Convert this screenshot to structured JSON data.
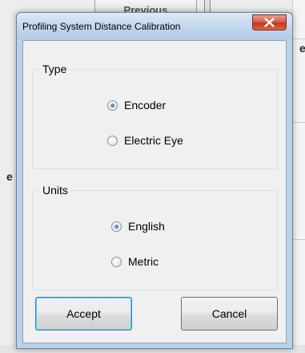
{
  "background": {
    "previous_button_label": "Previous",
    "left_glyph": "e",
    "right_glyph": "e"
  },
  "dialog": {
    "title": "Profiling System Distance Calibration",
    "close_icon": "close-x-icon",
    "type_group": {
      "label": "Type",
      "options": [
        {
          "label": "Encoder",
          "checked": true
        },
        {
          "label": "Electric Eye",
          "checked": false
        }
      ]
    },
    "units_group": {
      "label": "Units",
      "options": [
        {
          "label": "English",
          "checked": true
        },
        {
          "label": "Metric",
          "checked": false
        }
      ]
    },
    "accept_label": "Accept",
    "cancel_label": "Cancel"
  },
  "colors": {
    "frame": "#b9d1ea",
    "close_button": "#c3361c",
    "radio_dot": "#1b4f8c"
  }
}
